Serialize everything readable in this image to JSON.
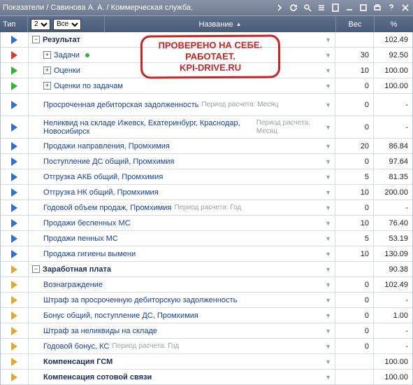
{
  "breadcrumb": "Показатели / Савинова А. А. / Коммерческая служба,",
  "header": {
    "type": "Тип",
    "level_select": "2",
    "scope_select": "Все",
    "name": "Название",
    "weight": "Вес",
    "percent": "%"
  },
  "stamp": {
    "line1": "ПРОВЕРЕНО НА СЕБЕ.",
    "line2": "РАБОТАЕТ.",
    "line3": "KPI-DRIVE.RU"
  },
  "rows": [
    {
      "tri": "blue",
      "indent": 0,
      "exp": "-",
      "bold": true,
      "name": "Результат",
      "meta": "",
      "weight": "",
      "pct": "102.49"
    },
    {
      "tri": "red",
      "indent": 1,
      "exp": "+",
      "bold": false,
      "name": "Задачи",
      "meta": "",
      "dot": true,
      "weight": "30",
      "pct": "92.50"
    },
    {
      "tri": "green",
      "indent": 1,
      "exp": "+",
      "bold": false,
      "name": "Оценки",
      "meta": "",
      "weight": "10",
      "pct": "100.00"
    },
    {
      "tri": "green",
      "indent": 1,
      "exp": "+",
      "bold": false,
      "name": "Оценки по задачам",
      "meta": "",
      "weight": "0",
      "pct": "100.00"
    },
    {
      "tri": "blue",
      "indent": 1,
      "exp": "",
      "bold": false,
      "name": "Просроченная дебиторская задолженность",
      "meta": "Период расчета: Месяц",
      "tall": true,
      "weight": "0",
      "pct": "-"
    },
    {
      "tri": "blue",
      "indent": 1,
      "exp": "",
      "bold": false,
      "name": "Неликвид на складе Ижевск, Екатеринбург, Краснодар, Новосибирск",
      "meta": "Период расчета: Месяц",
      "tall": true,
      "weight": "0",
      "pct": "-"
    },
    {
      "tri": "blue",
      "indent": 1,
      "exp": "",
      "bold": false,
      "name": "Продажи направления, Промхимия",
      "meta": "",
      "weight": "20",
      "pct": "86.84"
    },
    {
      "tri": "blue",
      "indent": 1,
      "exp": "",
      "bold": false,
      "name": "Поступление ДС общий, Промхимия",
      "meta": "",
      "weight": "0",
      "pct": "97.64"
    },
    {
      "tri": "blue",
      "indent": 1,
      "exp": "",
      "bold": false,
      "name": "Отгрузка АКБ общий, Промхимия",
      "meta": "",
      "weight": "5",
      "pct": "81.35"
    },
    {
      "tri": "blue",
      "indent": 1,
      "exp": "",
      "bold": false,
      "name": "Отгрузка НК общий, Промхимия",
      "meta": "",
      "weight": "10",
      "pct": "200.00"
    },
    {
      "tri": "blue",
      "indent": 1,
      "exp": "",
      "bold": false,
      "name": "Годовой объем продаж, Промхимия",
      "meta": "Период расчета: Год",
      "weight": "0",
      "pct": "-"
    },
    {
      "tri": "blue",
      "indent": 1,
      "exp": "",
      "bold": false,
      "name": "Продажи беспенных МС",
      "meta": "",
      "weight": "10",
      "pct": "76.40"
    },
    {
      "tri": "blue",
      "indent": 1,
      "exp": "",
      "bold": false,
      "name": "Продажи пенных МС",
      "meta": "",
      "weight": "5",
      "pct": "53.19"
    },
    {
      "tri": "blue",
      "indent": 1,
      "exp": "",
      "bold": false,
      "name": "Продажа гигиены вымени",
      "meta": "",
      "weight": "10",
      "pct": "130.09"
    },
    {
      "tri": "gold",
      "indent": 0,
      "exp": "-",
      "bold": true,
      "name": "Заработная плата",
      "meta": "",
      "weight": "",
      "pct": "90.38"
    },
    {
      "tri": "gold",
      "indent": 1,
      "exp": "",
      "bold": false,
      "name": "Вознаграждение",
      "meta": "",
      "weight": "0",
      "pct": "102.49"
    },
    {
      "tri": "gold",
      "indent": 1,
      "exp": "",
      "bold": false,
      "name": "Штраф за просроченную дебиторскую задолженность",
      "meta": "",
      "weight": "0",
      "pct": "-"
    },
    {
      "tri": "gold",
      "indent": 1,
      "exp": "",
      "bold": false,
      "name": "Бонус общий, поступление ДС, Промхимия",
      "meta": "",
      "weight": "0",
      "pct": "1.00"
    },
    {
      "tri": "gold",
      "indent": 1,
      "exp": "",
      "bold": false,
      "name": "Штраф за неликвиды на складе",
      "meta": "",
      "weight": "0",
      "pct": "-"
    },
    {
      "tri": "gold",
      "indent": 1,
      "exp": "",
      "bold": false,
      "name": "Годовой бонус, КС",
      "meta": "Период расчета: Год",
      "weight": "0",
      "pct": "-"
    },
    {
      "tri": "gold",
      "indent": 1,
      "exp": "",
      "bold": true,
      "name": "Компенсация ГСМ",
      "meta": "",
      "weight": "",
      "pct": "100.00"
    },
    {
      "tri": "gold",
      "indent": 1,
      "exp": "",
      "bold": true,
      "name": "Компенсация сотовой связи",
      "meta": "",
      "weight": "",
      "pct": "100.00"
    }
  ]
}
